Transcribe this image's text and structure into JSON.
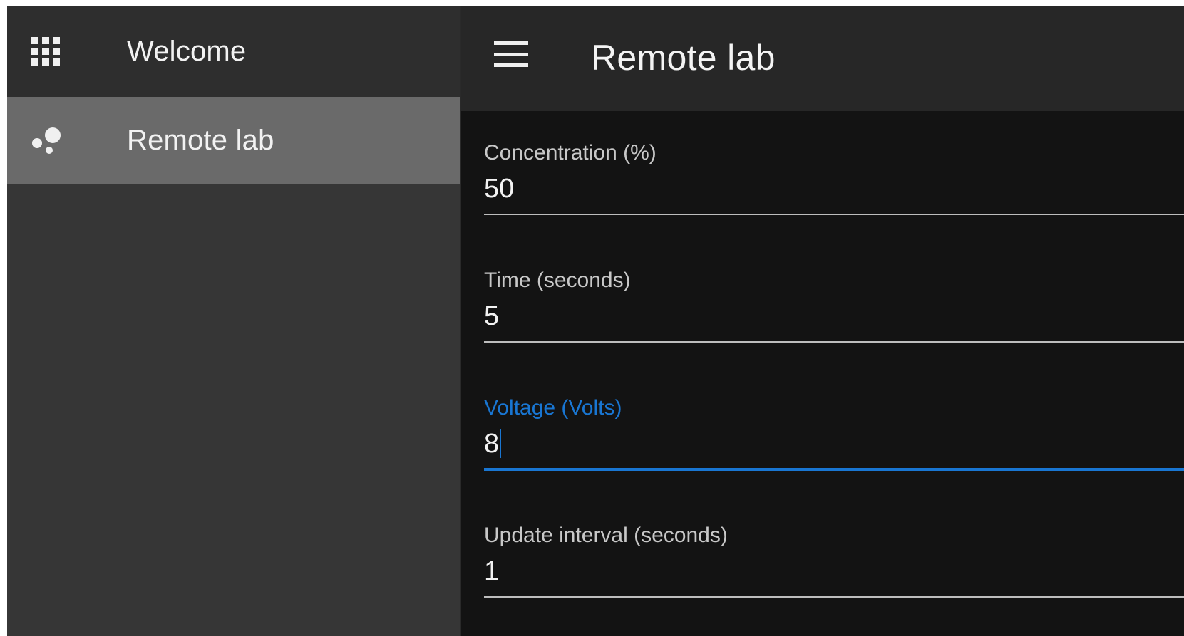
{
  "sidebar": {
    "header": {
      "label": "Welcome",
      "icon": "apps-grid-icon"
    },
    "items": [
      {
        "label": "Remote lab",
        "icon": "bubbles-icon",
        "selected": true
      }
    ]
  },
  "topbar": {
    "title": "Remote lab",
    "menu_icon": "menu-icon"
  },
  "form": {
    "fields": [
      {
        "label": "Concentration (%)",
        "value": "50",
        "active": false
      },
      {
        "label": "Time (seconds)",
        "value": "5",
        "active": false
      },
      {
        "label": "Voltage (Volts)",
        "value": "8",
        "active": true
      },
      {
        "label": "Update interval (seconds)",
        "value": "1",
        "active": false
      }
    ]
  },
  "colors": {
    "accent": "#1976d2",
    "sidebar_bg": "#363636",
    "sidebar_selected": "#6a6a6a",
    "topbar_bg": "#272727",
    "main_bg": "#131313"
  }
}
